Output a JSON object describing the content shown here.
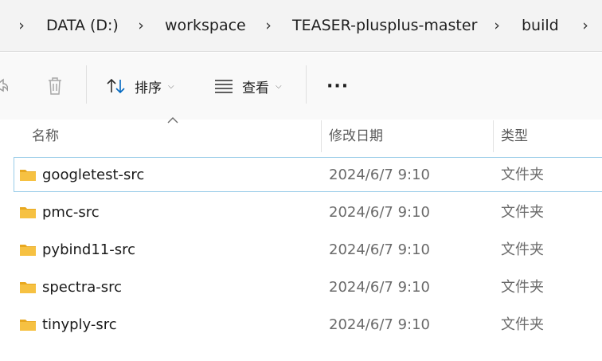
{
  "breadcrumb": {
    "items": [
      {
        "label": "DATA (D:)"
      },
      {
        "label": "workspace"
      },
      {
        "label": "TEASER-plusplus-master"
      },
      {
        "label": "build"
      }
    ]
  },
  "toolbar": {
    "sort_label": "排序",
    "view_label": "查看",
    "more_label": "···"
  },
  "columns": {
    "name": "名称",
    "date": "修改日期",
    "type": "类型"
  },
  "files": [
    {
      "name": "googletest-src",
      "date": "2024/6/7 9:10",
      "type": "文件夹",
      "selected": true
    },
    {
      "name": "pmc-src",
      "date": "2024/6/7 9:10",
      "type": "文件夹"
    },
    {
      "name": "pybind11-src",
      "date": "2024/6/7 9:10",
      "type": "文件夹"
    },
    {
      "name": "spectra-src",
      "date": "2024/6/7 9:10",
      "type": "文件夹"
    },
    {
      "name": "tinyply-src",
      "date": "2024/6/7 9:10",
      "type": "文件夹"
    }
  ],
  "colors": {
    "folder": "#f6c142",
    "selection_border": "#99cce8",
    "accent": "#0067c0"
  }
}
